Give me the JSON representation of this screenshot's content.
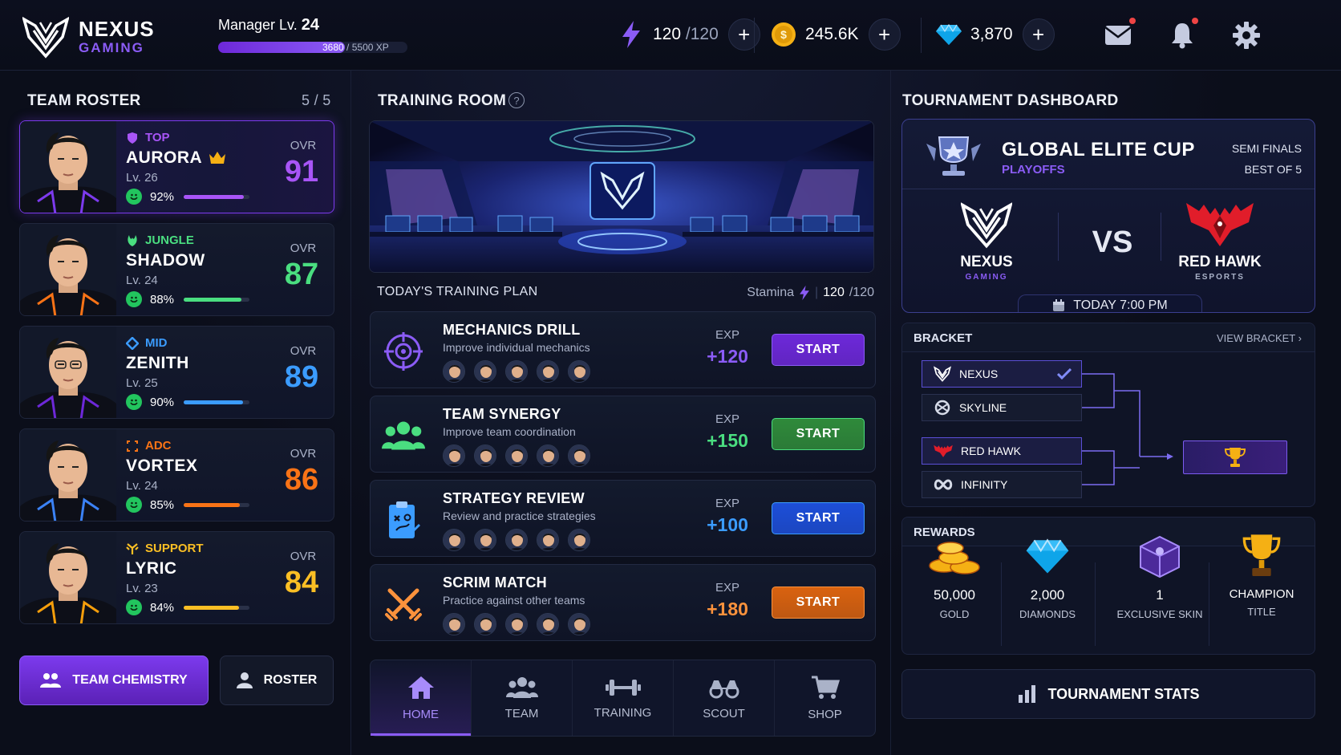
{
  "header": {
    "brand_name": "NEXUS",
    "brand_sub": "GAMING",
    "manager_label": "Manager Lv.",
    "manager_level": "24",
    "xp_current": "3680",
    "xp_max": "/ 5500 XP",
    "xp_fraction": 0.669,
    "energy_value": "120",
    "energy_max": "/120",
    "gold_value": "245.6K",
    "diamonds_value": "3,870",
    "plus_label": "+"
  },
  "roster": {
    "title": "TEAM ROSTER",
    "count": "5 / 5",
    "ovr_label": "OVR",
    "players": [
      {
        "role": "TOP",
        "name": "AURORA",
        "level": "Lv. 26",
        "mood": "92%",
        "mood_value": 0.92,
        "ovr": "91",
        "color": "#a855f7"
      },
      {
        "role": "JUNGLE",
        "name": "SHADOW",
        "level": "Lv. 24",
        "mood": "88%",
        "mood_value": 0.88,
        "ovr": "87",
        "color": "#4ade80"
      },
      {
        "role": "MID",
        "name": "ZENITH",
        "level": "Lv. 25",
        "mood": "90%",
        "mood_value": 0.9,
        "ovr": "89",
        "color": "#3b9cff"
      },
      {
        "role": "ADC",
        "name": "VORTEX",
        "level": "Lv. 24",
        "mood": "85%",
        "mood_value": 0.85,
        "ovr": "86",
        "color": "#f97316"
      },
      {
        "role": "SUPPORT",
        "name": "LYRIC",
        "level": "Lv. 23",
        "mood": "84%",
        "mood_value": 0.84,
        "ovr": "84",
        "color": "#fbbf24"
      }
    ],
    "chemistry_button": "TEAM CHEMISTRY",
    "roster_button": "ROSTER"
  },
  "training": {
    "title": "TRAINING ROOM",
    "help": "?",
    "plan_title": "TODAY'S TRAINING PLAN",
    "stamina_label": "Stamina",
    "stamina_value": "120",
    "stamina_max": "/120",
    "exp_label": "EXP",
    "drills": [
      {
        "title": "MECHANICS DRILL",
        "desc": "Improve individual mechanics",
        "exp": "+120",
        "start": "START",
        "color": "#8b5cf6",
        "btn": "#6d28d9"
      },
      {
        "title": "TEAM SYNERGY",
        "desc": "Improve team coordination",
        "exp": "+150",
        "start": "START",
        "color": "#4ade80",
        "btn": "#2f8a3a"
      },
      {
        "title": "STRATEGY REVIEW",
        "desc": "Review and practice strategies",
        "exp": "+100",
        "start": "START",
        "color": "#3b9cff",
        "btn": "#1d4ed8"
      },
      {
        "title": "SCRIM MATCH",
        "desc": "Practice against other teams",
        "exp": "+180",
        "start": "START",
        "color": "#fb923c",
        "btn": "#d9620f"
      }
    ]
  },
  "nav": {
    "items": [
      {
        "label": "HOME"
      },
      {
        "label": "TEAM"
      },
      {
        "label": "TRAINING"
      },
      {
        "label": "SCOUT"
      },
      {
        "label": "SHOP"
      }
    ]
  },
  "tournament": {
    "title": "TOURNAMENT DASHBOARD",
    "cup_name": "GLOBAL ELITE CUP",
    "cup_stage": "PLAYOFFS",
    "round": "SEMI FINALS",
    "format": "BEST OF 5",
    "vs": "VS",
    "team_a": "NEXUS",
    "team_a_sub": "GAMING",
    "team_b": "RED HAWK",
    "team_b_sub": "ESPORTS",
    "match_time": "TODAY 7:00 PM",
    "bracket_title": "BRACKET",
    "view_bracket": "VIEW BRACKET",
    "bracket_teams": [
      "NEXUS",
      "SKYLINE",
      "RED HAWK",
      "INFINITY"
    ],
    "rewards_title": "REWARDS",
    "rewards": [
      {
        "value": "50,000",
        "label": "GOLD"
      },
      {
        "value": "2,000",
        "label": "DIAMONDS"
      },
      {
        "value": "1",
        "label": "EXCLUSIVE SKIN"
      },
      {
        "value": "CHAMPION",
        "label": "TITLE"
      }
    ],
    "stats_button": "TOURNAMENT STATS"
  }
}
